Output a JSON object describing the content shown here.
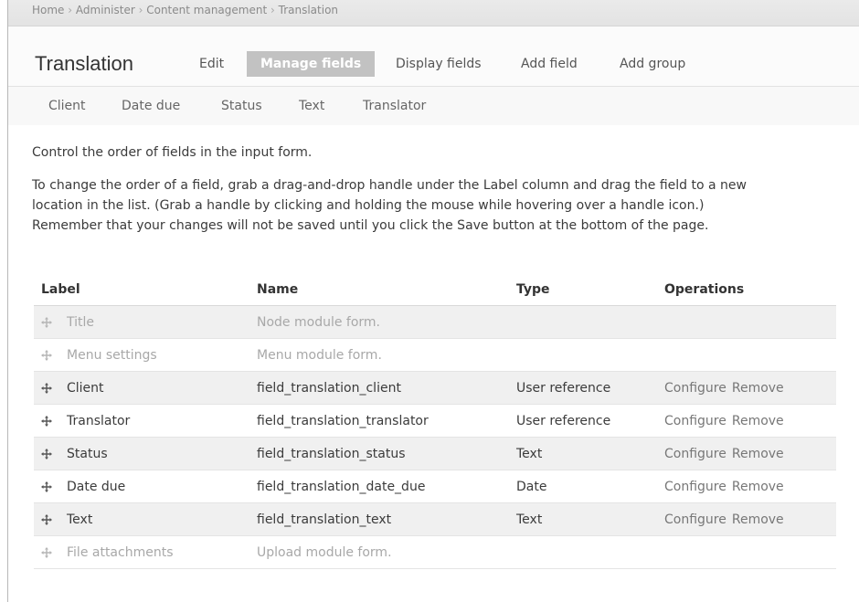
{
  "breadcrumb": [
    "Home",
    "Administer",
    "Content management",
    "Translation"
  ],
  "breadcrumb_separator": "›",
  "page_title": "Translation",
  "tabs": [
    {
      "label": "Edit",
      "active": false
    },
    {
      "label": "Manage fields",
      "active": true
    },
    {
      "label": "Display fields",
      "active": false
    },
    {
      "label": "Add field",
      "active": false
    },
    {
      "label": "Add group",
      "active": false
    }
  ],
  "subtabs": [
    "Client",
    "Date due",
    "Status",
    "Text",
    "Translator"
  ],
  "description": {
    "intro": "Control the order of fields in the input form.",
    "instructions_1": "To change the order of a field, grab a drag-and-drop handle under the Label column and drag the field to a new",
    "instructions_2": "location in the list. (Grab a handle by clicking and holding the mouse while hovering over a handle icon.)",
    "instructions_3": "Remember that your changes will not be saved until you click the Save button at the bottom of the page."
  },
  "table": {
    "headers": {
      "label": "Label",
      "name": "Name",
      "type": "Type",
      "operations": "Operations"
    },
    "rows": [
      {
        "label": "Title",
        "name": "Node module form.",
        "type": "",
        "configure": "",
        "remove": "",
        "disabled": true
      },
      {
        "label": "Menu settings",
        "name": "Menu module form.",
        "type": "",
        "configure": "",
        "remove": "",
        "disabled": true
      },
      {
        "label": "Client",
        "name": "field_translation_client",
        "type": "User reference",
        "configure": "Configure",
        "remove": "Remove",
        "disabled": false
      },
      {
        "label": "Translator",
        "name": "field_translation_translator",
        "type": "User reference",
        "configure": "Configure",
        "remove": "Remove",
        "disabled": false
      },
      {
        "label": "Status",
        "name": "field_translation_status",
        "type": "Text",
        "configure": "Configure",
        "remove": "Remove",
        "disabled": false
      },
      {
        "label": "Date due",
        "name": "field_translation_date_due",
        "type": "Date",
        "configure": "Configure",
        "remove": "Remove",
        "disabled": false
      },
      {
        "label": "Text",
        "name": "field_translation_text",
        "type": "Text",
        "configure": "Configure",
        "remove": "Remove",
        "disabled": false
      },
      {
        "label": "File attachments",
        "name": "Upload module form.",
        "type": "",
        "configure": "",
        "remove": "",
        "disabled": true
      }
    ]
  },
  "colors": {
    "active_tab_bg": "#c2c2c2",
    "row_shade": "#f0f0f0",
    "disabled_text": "#a8a8a8"
  },
  "icons": {
    "row_handle": "drag-handle-icon"
  }
}
